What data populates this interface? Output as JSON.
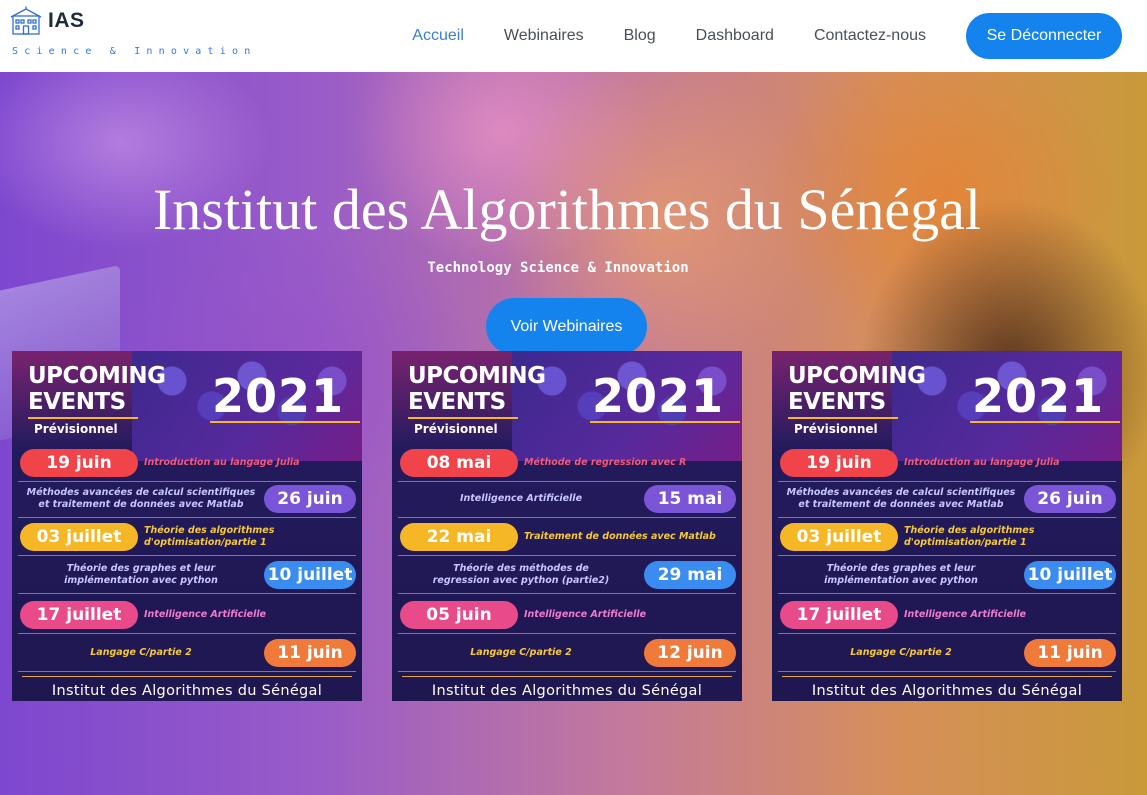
{
  "brand": {
    "name": "IAS",
    "tagline": "Science & Innovation"
  },
  "nav": {
    "links": [
      "Accueil",
      "Webinaires",
      "Blog",
      "Dashboard",
      "Contactez-nous"
    ],
    "logout_label": "Se Déconnecter"
  },
  "hero": {
    "title": "Institut des Algorithmes du Sénégal",
    "subtitle": "Technology Science & Innovation",
    "cta_label": "Voir Webinaires"
  },
  "colors": {
    "accent": "#1583ee",
    "nav_active": "#3a7fd0",
    "poster_bg": "#221a5a",
    "gold": "#f6b726"
  },
  "posters": [
    {
      "upcoming": "UPCOMING",
      "events": "EVENTS",
      "year": "2021",
      "prev": "Prévisionnel",
      "rows": [
        {
          "date": "19 juin",
          "topic": "Introduction au langage Julia",
          "side": "left",
          "color": "#f0444a"
        },
        {
          "date": "26 juin",
          "topic": "Méthodes avancées de calcul scientifiques\net traitement de données avec Matlab",
          "side": "right",
          "color": "#7a55d8"
        },
        {
          "date": "03 juillet",
          "topic": "Théorie des algorithmes\nd'optimisation/partie 1",
          "side": "left",
          "color": "#f6b726"
        },
        {
          "date": "10 juillet",
          "topic": "Théorie des graphes et leur\nimplémentation avec python",
          "side": "right",
          "color": "#3b8cf0"
        },
        {
          "date": "17 juillet",
          "topic": "Intelligence Artificielle",
          "side": "left",
          "color": "#e84a8a"
        },
        {
          "date": "11 juin",
          "topic": "Langage C/partie 2",
          "side": "right",
          "color": "#f07a3a"
        }
      ],
      "footer": "Institut des Algorithmes du Sénégal"
    },
    {
      "upcoming": "UPCOMING",
      "events": "EVENTS",
      "year": "2021",
      "prev": "Prévisionnel",
      "rows": [
        {
          "date": "08 mai",
          "topic": "Méthode de regression avec R",
          "side": "left",
          "color": "#f0444a"
        },
        {
          "date": "15 mai",
          "topic": "Intelligence Artificielle",
          "side": "right",
          "color": "#7a55d8"
        },
        {
          "date": "22 mai",
          "topic": "Traitement de données avec Matlab",
          "side": "left",
          "color": "#f6b726"
        },
        {
          "date": "29 mai",
          "topic": "Théorie des méthodes de\nregression avec python (partie2)",
          "side": "right",
          "color": "#3b8cf0"
        },
        {
          "date": "05 juin",
          "topic": "Intelligence Artificielle",
          "side": "left",
          "color": "#e84a8a"
        },
        {
          "date": "12 juin",
          "topic": "Langage C/partie 2",
          "side": "right",
          "color": "#f07a3a"
        }
      ],
      "footer": "Institut des Algorithmes du Sénégal"
    },
    {
      "upcoming": "UPCOMING",
      "events": "EVENTS",
      "year": "2021",
      "prev": "Prévisionnel",
      "rows": [
        {
          "date": "19 juin",
          "topic": "Introduction au langage Julia",
          "side": "left",
          "color": "#f0444a"
        },
        {
          "date": "26 juin",
          "topic": "Méthodes avancées de calcul scientifiques\net traitement de données avec Matlab",
          "side": "right",
          "color": "#7a55d8"
        },
        {
          "date": "03 juillet",
          "topic": "Théorie des algorithmes\nd'optimisation/partie 1",
          "side": "left",
          "color": "#f6b726"
        },
        {
          "date": "10 juillet",
          "topic": "Théorie des graphes et leur\nimplémentation avec python",
          "side": "right",
          "color": "#3b8cf0"
        },
        {
          "date": "17 juillet",
          "topic": "Intelligence Artificielle",
          "side": "left",
          "color": "#e84a8a"
        },
        {
          "date": "11 juin",
          "topic": "Langage C/partie 2",
          "side": "right",
          "color": "#f07a3a"
        }
      ],
      "footer": "Institut des Algorithmes du Sénégal"
    }
  ]
}
